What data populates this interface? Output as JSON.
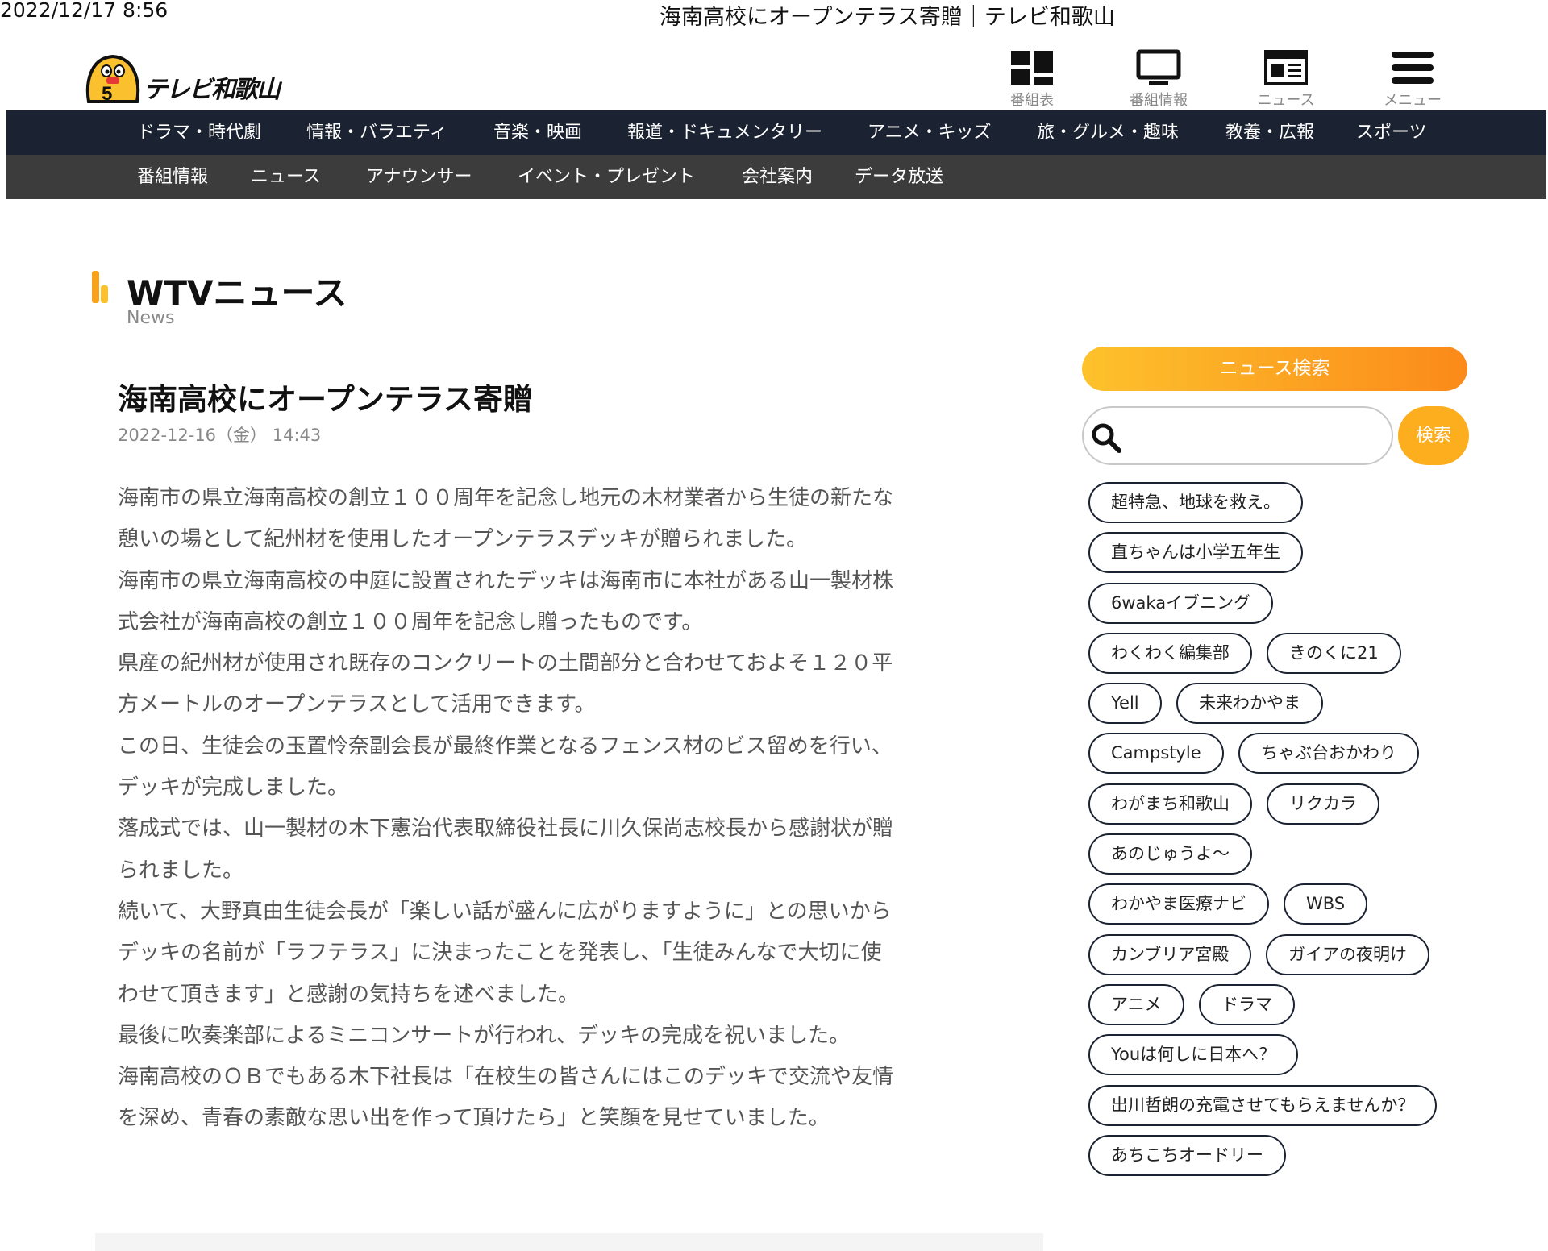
{
  "print": {
    "date": "2022/12/17 8:56",
    "title": "海南高校にオープンテラス寄贈｜テレビ和歌山"
  },
  "logo": {
    "text": "テレビ和歌山",
    "colors": {
      "body": "#fbc02d",
      "outline": "#111111",
      "accent": "#e53935"
    }
  },
  "top_icons": [
    {
      "label": "番組表",
      "icon": "grid-icon"
    },
    {
      "label": "番組情報",
      "icon": "monitor-icon"
    },
    {
      "label": "ニュース",
      "icon": "newspaper-icon"
    },
    {
      "label": "メニュー",
      "icon": "hamburger-icon"
    }
  ],
  "nav1": [
    "ドラマ・時代劇",
    "情報・バラエティ",
    "音楽・映画",
    "報道・ドキュメンタリー",
    "アニメ・キッズ",
    "旅・グルメ・趣味",
    "教養・広報",
    "スポーツ"
  ],
  "nav2": [
    "番組情報",
    "ニュース",
    "アナウンサー",
    "イベント・プレゼント",
    "会社案内",
    "データ放送"
  ],
  "section": {
    "title": "WTVニュース",
    "subtitle": "News"
  },
  "article": {
    "title": "海南高校にオープンテラス寄贈",
    "date": "2022-12-16（金） 14:43",
    "lines": [
      "海南市の県立海南高校の創立１００周年を記念し地元の木材業者から生徒の新たな",
      "憩いの場として紀州材を使用したオープンテラスデッキが贈られました。",
      "海南市の県立海南高校の中庭に設置されたデッキは海南市に本社がある山一製材株",
      "式会社が海南高校の創立１００周年を記念し贈ったものです。",
      "県産の紀州材が使用され既存のコンクリートの土間部分と合わせておよそ１２０平",
      "方メートルのオープンテラスとして活用できます。",
      "この日、生徒会の玉置怜奈副会長が最終作業となるフェンス材のビス留めを行い、",
      "デッキが完成しました。",
      "落成式では、山一製材の木下憲治代表取締役社長に川久保尚志校長から感謝状が贈",
      "られました。",
      "続いて、大野真由生徒会長が「楽しい話が盛んに広がりますように」との思いから",
      "デッキの名前が「ラフテラス」に決まったことを発表し、「生徒みんなで大切に使",
      "わせて頂きます」と感謝の気持ちを述べました。",
      "最後に吹奏楽部によるミニコンサートが行われ、デッキの完成を祝いました。",
      "海南高校のＯＢでもある木下社長は「在校生の皆さんにはこのデッキで交流や友情",
      "を深め、青春の素敵な思い出を作って頂けたら」と笑顔を見せていました。"
    ]
  },
  "search": {
    "title": "ニュース検索",
    "placeholder": "",
    "button": "検索",
    "colors": {
      "gradient_start": "#fdc22c",
      "gradient_end": "#fb8a1a"
    }
  },
  "tag_rows": [
    [
      "超特急、地球を救え。"
    ],
    [
      "直ちゃんは小学五年生"
    ],
    [
      "6wakaイブニング"
    ],
    [
      "わくわく編集部",
      "きのくに21"
    ],
    [
      "Yell",
      "未来わかやま"
    ],
    [
      "Campstyle",
      "ちゃぶ台おかわり"
    ],
    [
      "わがまち和歌山",
      "リクカラ"
    ],
    [
      "あのじゅうよ～"
    ],
    [
      "わかやま医療ナビ",
      "WBS"
    ],
    [
      "カンブリア宮殿",
      "ガイアの夜明け"
    ],
    [
      "アニメ",
      "ドラマ"
    ],
    [
      "Youは何しに日本へ？"
    ],
    [
      "出川哲朗の充電させてもらえませんか？"
    ],
    [
      "あちこちオードリー"
    ]
  ]
}
